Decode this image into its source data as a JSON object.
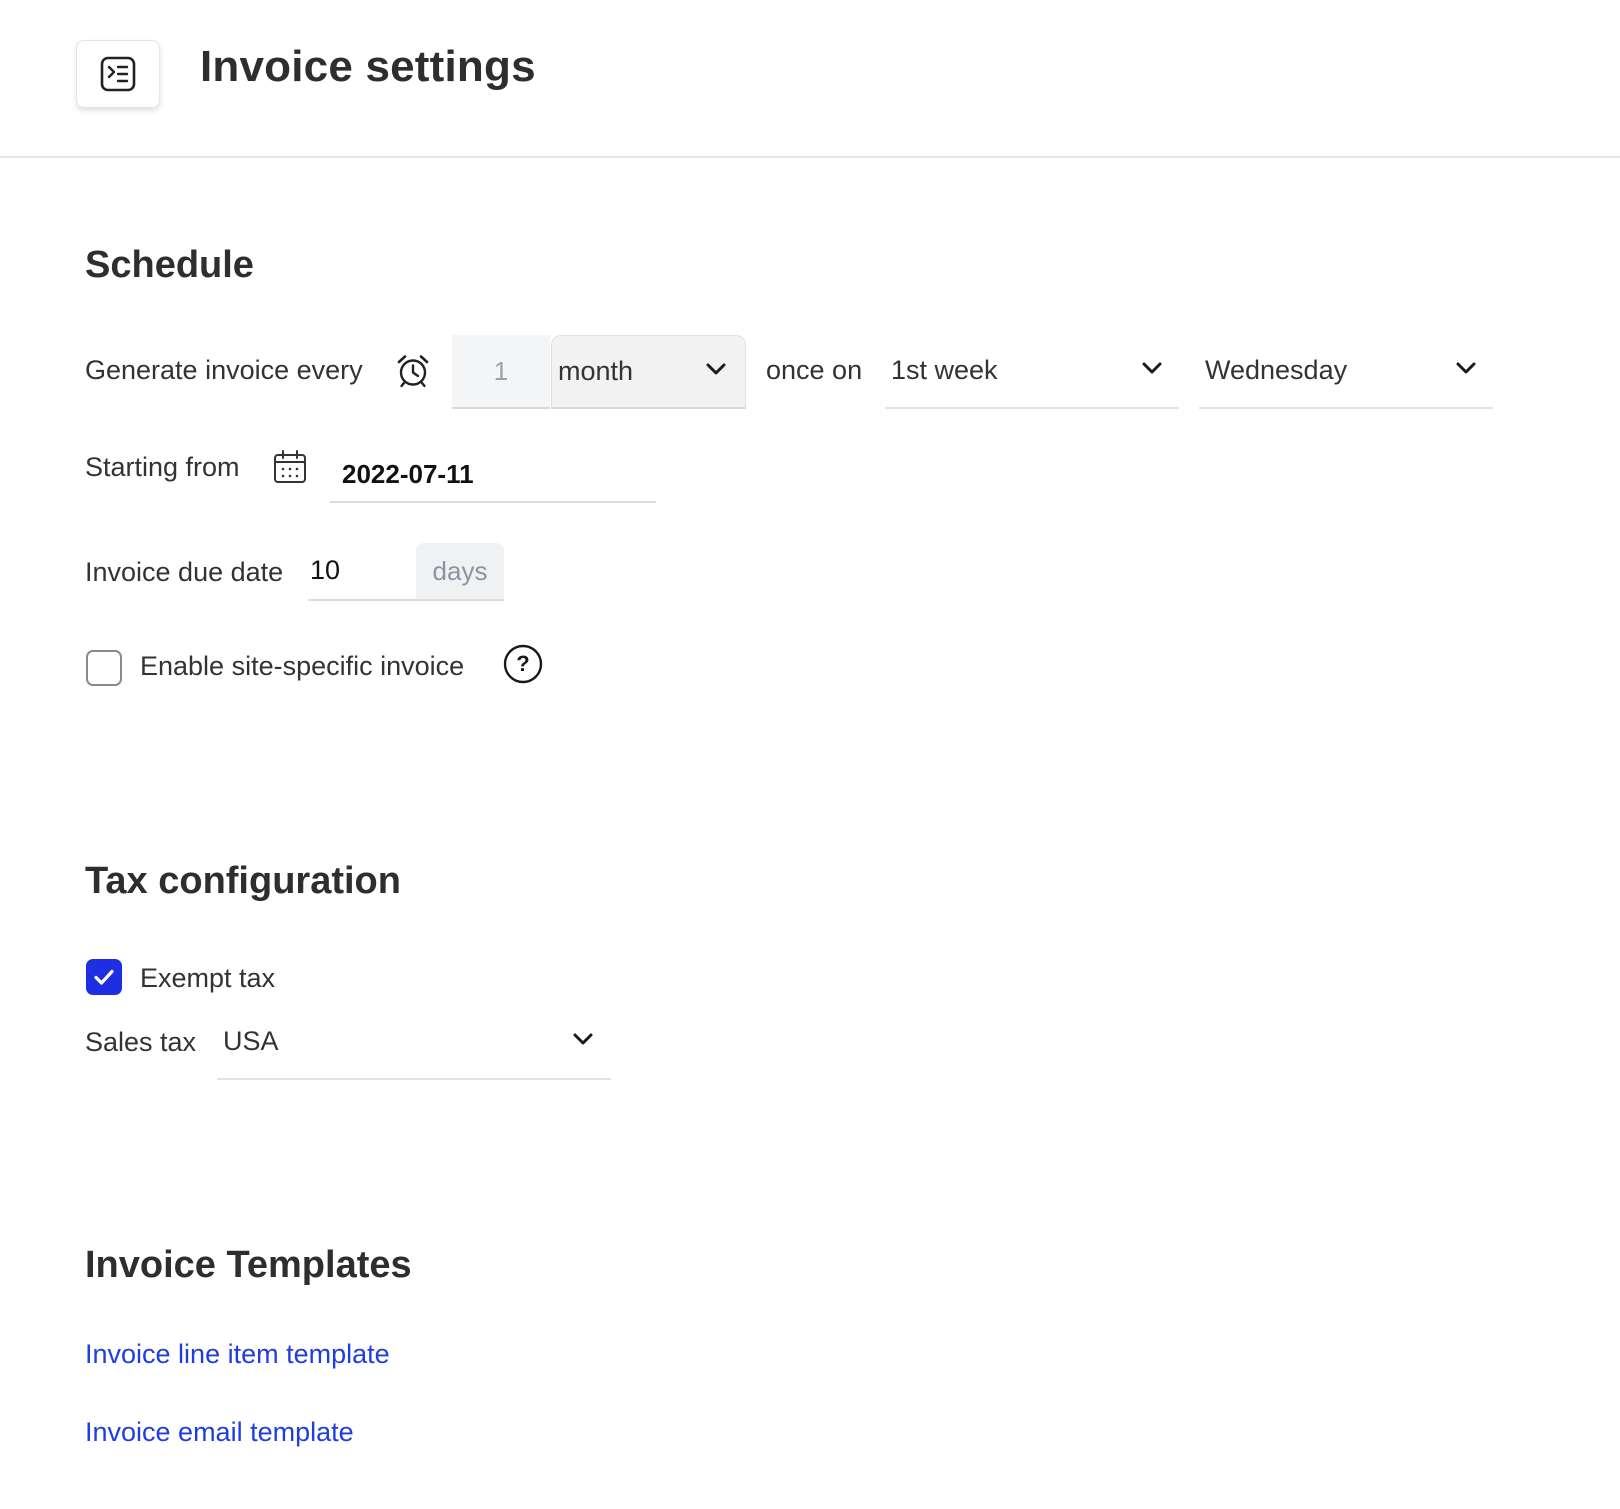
{
  "header": {
    "title": "Invoice settings",
    "menu_icon": "sidebar-toggle-icon"
  },
  "schedule": {
    "title": "Schedule",
    "generate_label": "Generate invoice every",
    "generate_icon": "alarm-clock-icon",
    "interval_placeholder": "1",
    "interval_unit": "month",
    "once_on_label": "once on",
    "week_value": "1st week",
    "day_value": "Wednesday",
    "starting_label": "Starting from",
    "starting_icon": "calendar-icon",
    "start_date": "2022-07-11",
    "due_label": "Invoice due date",
    "due_value": "10",
    "due_unit": "days",
    "site_specific_label": "Enable site-specific invoice",
    "site_specific_checked": false,
    "help_icon": "help-circle-icon"
  },
  "tax": {
    "title": "Tax configuration",
    "exempt_label": "Exempt tax",
    "exempt_checked": true,
    "sales_tax_label": "Sales tax",
    "sales_tax_value": "USA"
  },
  "templates": {
    "title": "Invoice Templates",
    "line_item_link": "Invoice line item template",
    "email_link": "Invoice email template"
  },
  "colors": {
    "accent": "#1d2fe0",
    "link": "#1f3de0",
    "text": "#2e2e2e"
  }
}
